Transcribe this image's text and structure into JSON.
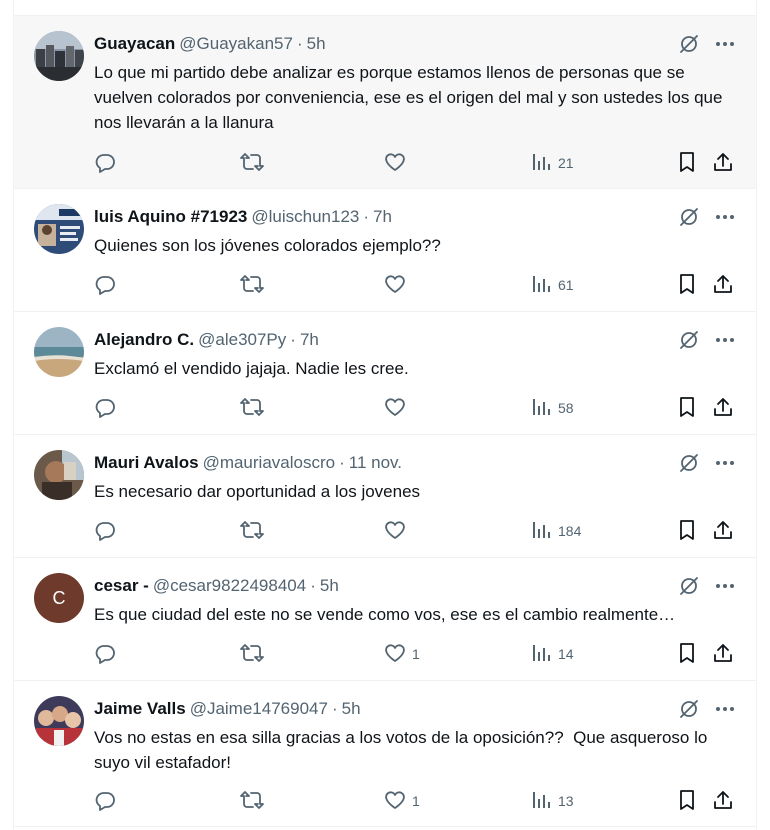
{
  "tweets": [
    {
      "name": "Guayacan",
      "handle": "@Guayakan57",
      "time": "5h",
      "text": "Lo que mi partido debe analizar es porque estamos llenos de personas que se vuelven colorados por conveniencia, ese es el origen del mal y son ustedes los que nos llevarán a la llanura",
      "likes": "",
      "views": "21",
      "avatar": "photo-city"
    },
    {
      "name": "luis Aquino #71923",
      "handle": "@luischun123",
      "time": "7h",
      "text": "Quienes son los jóvenes colorados ejemplo??",
      "likes": "",
      "views": "61",
      "avatar": "photo-poster"
    },
    {
      "name": "Alejandro C.",
      "handle": "@ale307Py",
      "time": "7h",
      "text": "Exclamó el vendido jajaja. Nadie les cree.",
      "likes": "",
      "views": "58",
      "avatar": "photo-beach"
    },
    {
      "name": "Mauri Avalos",
      "handle": "@mauriavaloscro",
      "time": "11 nov.",
      "text": "Es necesario dar oportunidad a los jovenes",
      "likes": "",
      "views": "184",
      "avatar": "photo-person"
    },
    {
      "name": "cesar -",
      "handle": "@cesar9822498404",
      "time": "5h",
      "text": "Es que ciudad del este no se vende como vos, ese es el cambio realmente…",
      "likes": "1",
      "views": "14",
      "avatar": "letter",
      "avatar_letter": "C"
    },
    {
      "name": "Jaime Valls",
      "handle": "@Jaime14769047",
      "time": "5h",
      "text": "Vos no estas en esa silla gracias a los votos de la oposición??  Que asqueroso lo suyo vil estafador!",
      "likes": "1",
      "views": "13",
      "avatar": "photo-group"
    }
  ],
  "separator": "·",
  "colors": {
    "text": "#0f1419",
    "secondary": "#536471",
    "border": "#eff3f4",
    "highlight": "#f7f7f7",
    "avatar_letter_bg": "#6d3a2b"
  },
  "icons": {
    "reply": "reply-icon",
    "retweet": "retweet-icon",
    "like": "like-icon",
    "views": "views-icon",
    "bookmark": "bookmark-icon",
    "share": "share-icon",
    "grok": "grok-icon",
    "more": "more-icon"
  }
}
